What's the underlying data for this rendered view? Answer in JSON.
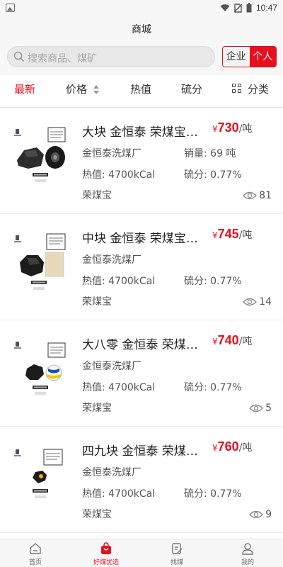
{
  "status_bar": {
    "time": "10:47"
  },
  "header": {
    "title": "商城"
  },
  "search": {
    "placeholder": "搜索商品、煤矿"
  },
  "account_toggle": {
    "company": "企业",
    "personal": "个人"
  },
  "filters": [
    {
      "label": "最新",
      "active": true
    },
    {
      "label": "价格",
      "active": false
    },
    {
      "label": "热值",
      "active": false
    },
    {
      "label": "硫分",
      "active": false
    },
    {
      "label": "分类",
      "active": false
    }
  ],
  "products": [
    {
      "name": "大块 金恒泰 荣煤宝一…",
      "currency": "¥",
      "price": "730",
      "unit": "/吨",
      "supplier": "金恒泰洗煤厂",
      "sales_label": "销量:",
      "sales": "69 吨",
      "heat_label": "热值:",
      "heat": "4700kCal",
      "sulfur_label": "硫分:",
      "sulfur": "0.77%",
      "brand": "荣煤宝",
      "views": "81"
    },
    {
      "name": "中块 金恒泰 荣煤宝一…",
      "currency": "¥",
      "price": "745",
      "unit": "/吨",
      "supplier": "金恒泰洗煤厂",
      "heat_label": "热值:",
      "heat": "4700kCal",
      "sulfur_label": "硫分:",
      "sulfur": "0.77%",
      "brand": "荣煤宝",
      "views": "14"
    },
    {
      "name": "大八零 金恒泰 荣煤宝…",
      "currency": "¥",
      "price": "740",
      "unit": "/吨",
      "supplier": "金恒泰洗煤厂",
      "heat_label": "热值:",
      "heat": "4700kCal",
      "sulfur_label": "硫分:",
      "sulfur": "0.77%",
      "brand": "荣煤宝",
      "views": "5"
    },
    {
      "name": "四九块 金恒泰 荣煤宝…",
      "currency": "¥",
      "price": "760",
      "unit": "/吨",
      "supplier": "金恒泰洗煤厂",
      "heat_label": "热值:",
      "heat": "4700kCal",
      "sulfur_label": "硫分:",
      "sulfur": "0.77%",
      "brand": "荣煤宝",
      "views": "9"
    }
  ],
  "bottom_nav": [
    {
      "label": "首页",
      "icon": "home-icon",
      "active": false
    },
    {
      "label": "好煤优选",
      "icon": "shopping-bag-icon",
      "active": true
    },
    {
      "label": "找煤",
      "icon": "find-coal-icon",
      "active": false
    },
    {
      "label": "我的",
      "icon": "profile-icon",
      "active": false
    }
  ],
  "colors": {
    "accent": "#e8101e",
    "background": "#f7f7f7"
  }
}
